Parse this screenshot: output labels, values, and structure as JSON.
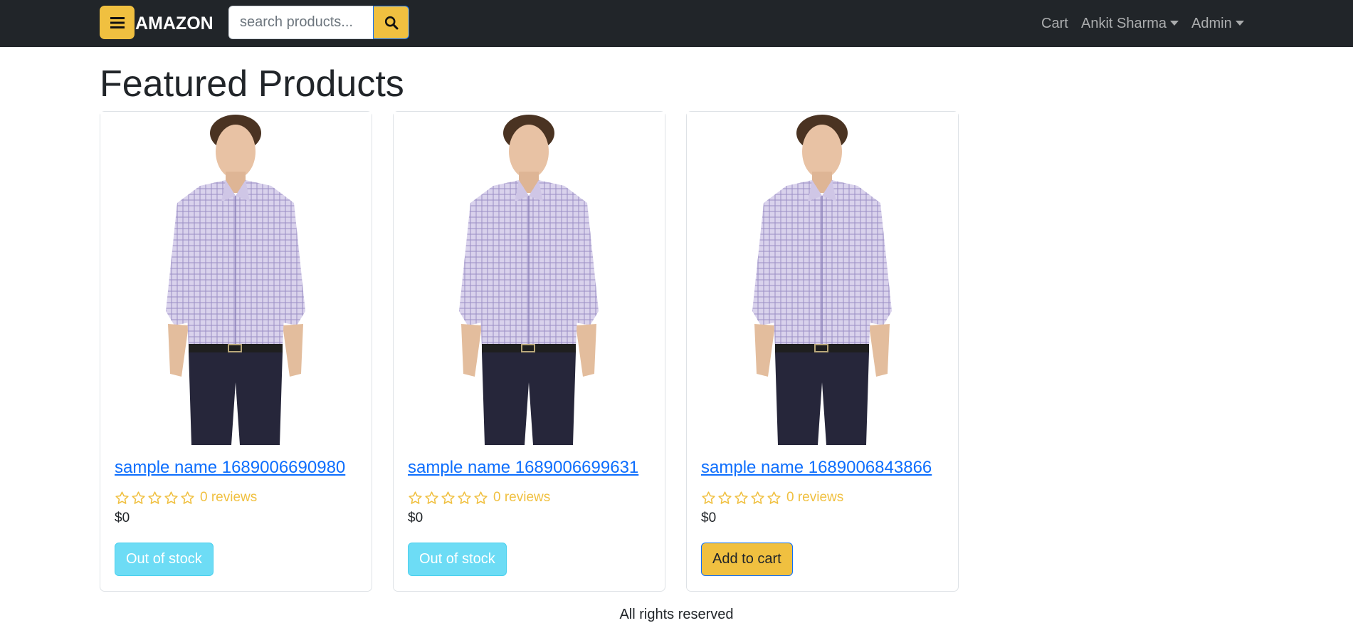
{
  "navbar": {
    "brand": "AMAZON",
    "menu_icon": "hamburger-icon",
    "search": {
      "placeholder": "search products...",
      "value": "",
      "icon": "search-icon"
    },
    "links": {
      "cart": "Cart",
      "user": "Ankit Sharma",
      "admin": "Admin"
    }
  },
  "main": {
    "heading": "Featured Products",
    "products": [
      {
        "name": "sample name 1689006690980",
        "rating": 0,
        "reviews": "0 reviews",
        "price": "$0",
        "button": "Out of stock",
        "in_stock": false
      },
      {
        "name": "sample name 1689006699631",
        "rating": 0,
        "reviews": "0 reviews",
        "price": "$0",
        "button": "Out of stock",
        "in_stock": false
      },
      {
        "name": "sample name 1689006843866",
        "rating": 0,
        "reviews": "0 reviews",
        "price": "$0",
        "button": "Add to cart",
        "in_stock": true
      }
    ]
  },
  "footer": {
    "text": "All rights reserved"
  },
  "colors": {
    "navbar_bg": "#212529",
    "accent_yellow": "#f0c040",
    "link_blue": "#0d6efd",
    "out_of_stock_btn": "#6ddcf5",
    "star_color": "#f0c040"
  }
}
